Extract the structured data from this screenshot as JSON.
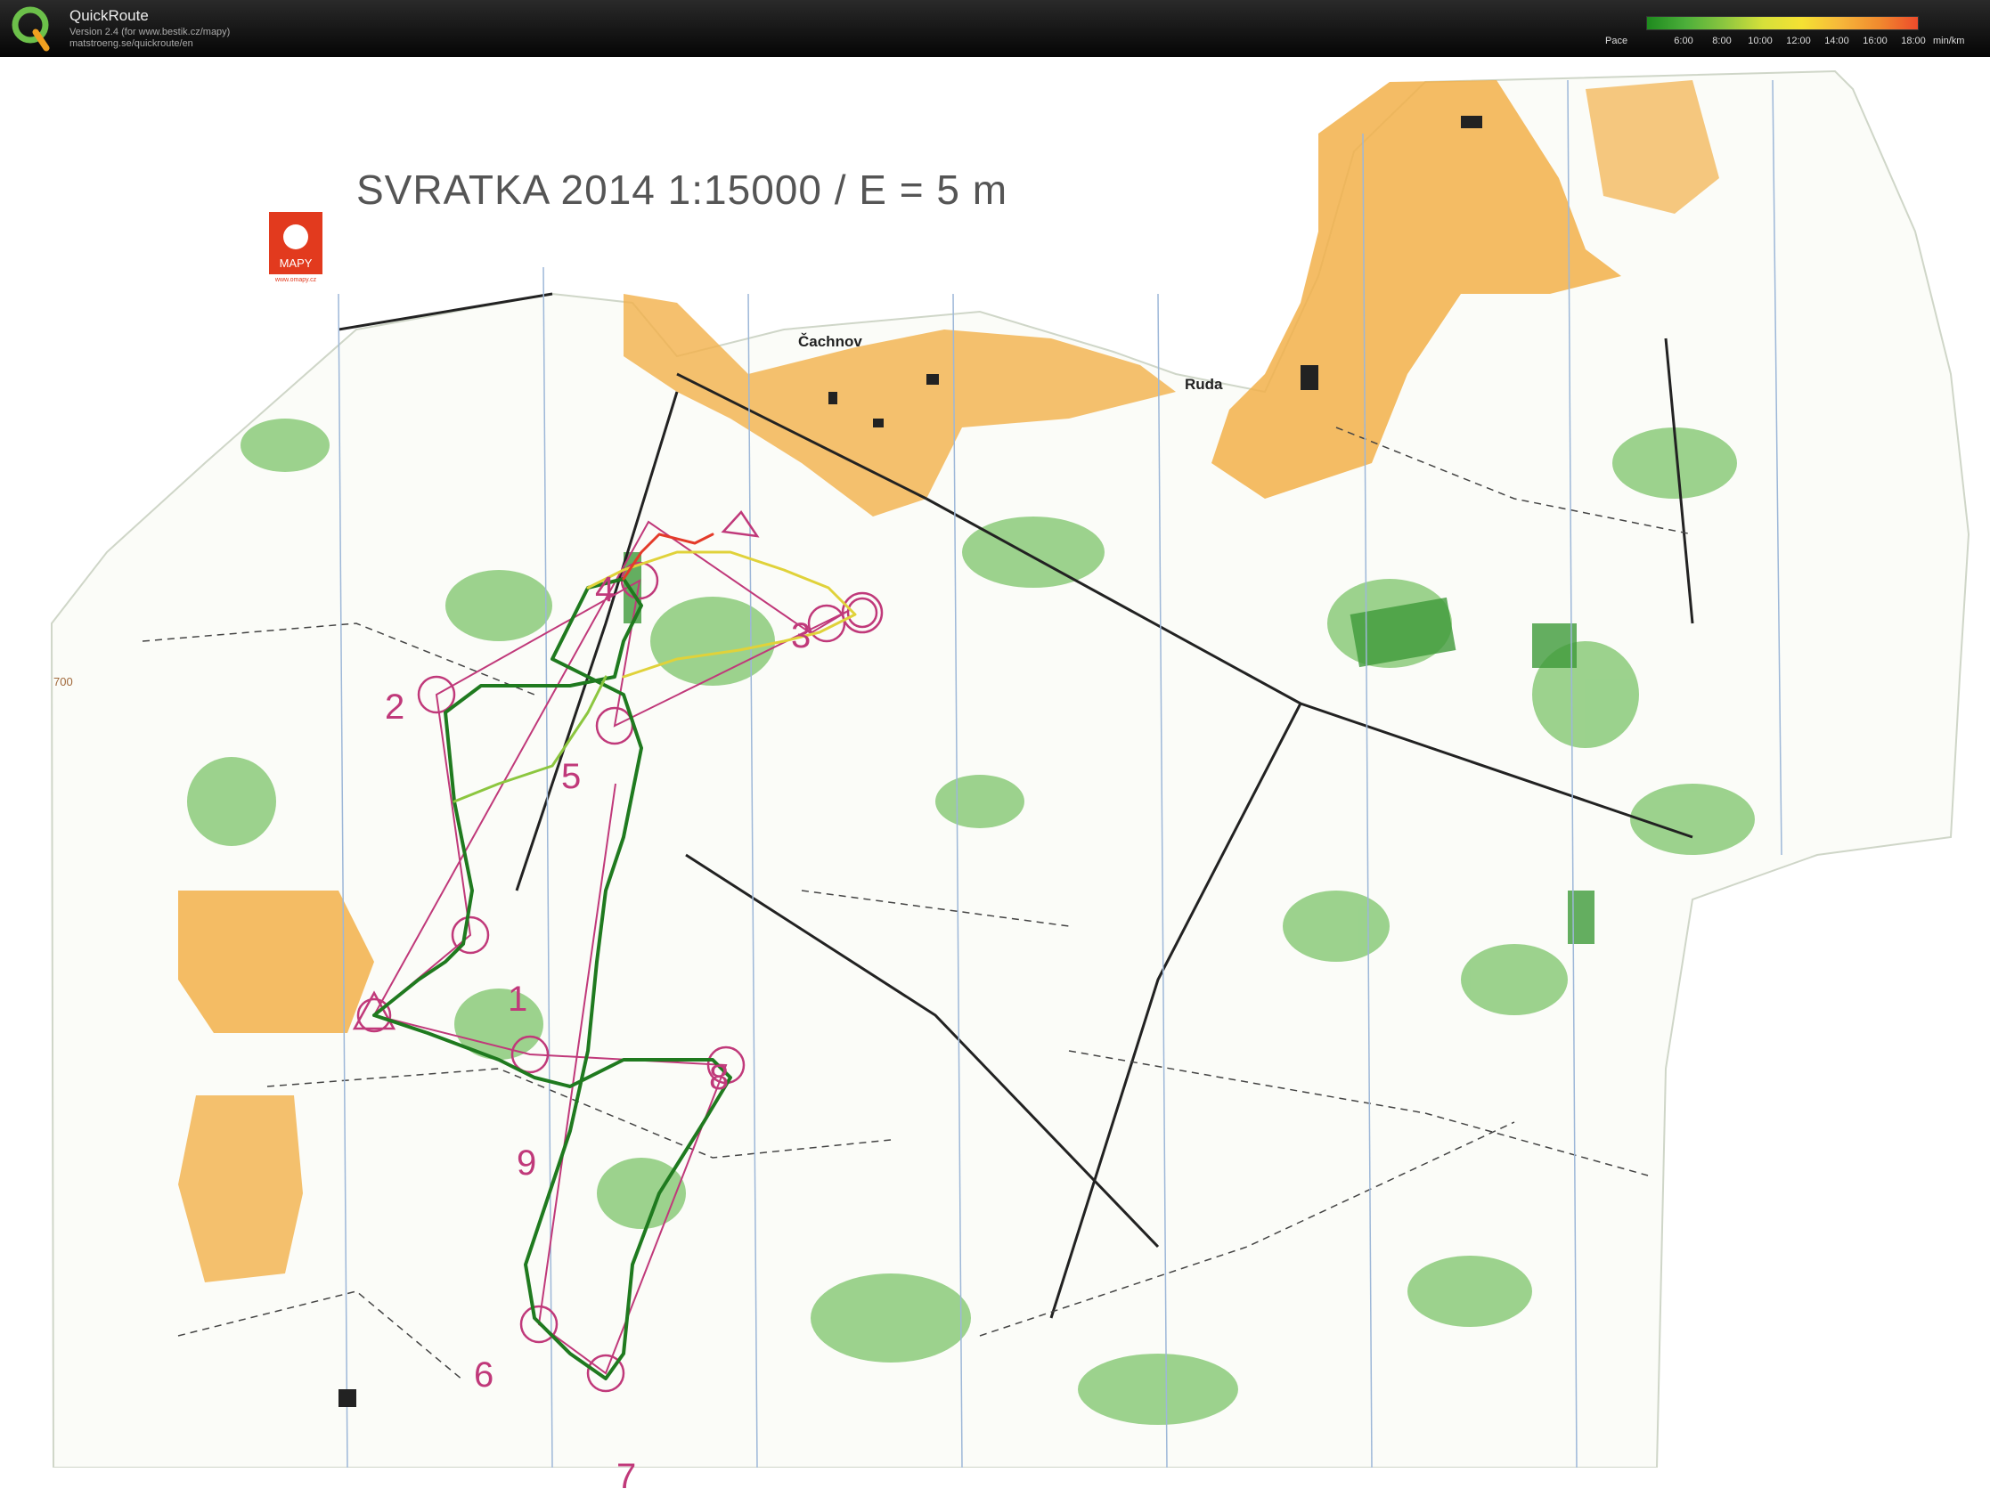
{
  "app": {
    "name": "QuickRoute",
    "version": "Version 2.4  (for www.bestik.cz/mapy)",
    "url": "matstroeng.se/quickroute/en"
  },
  "pace_legend": {
    "label": "Pace",
    "ticks": [
      "6:00",
      "8:00",
      "10:00",
      "12:00",
      "14:00",
      "16:00",
      "18:00"
    ],
    "unit": "min/km"
  },
  "map": {
    "title": "SVRATKA 2014    1:15000 / E = 5 m",
    "brand": "MAPY",
    "brand_url": "www.omapy.cz",
    "places": [
      "Čachnov",
      "Ruda"
    ],
    "contour_label": "700",
    "controls": [
      "1",
      "2",
      "3",
      "4",
      "5",
      "6",
      "7",
      "8",
      "9"
    ]
  },
  "colors": {
    "open_land": "#f2b04a",
    "forest_green": "#6dbb5a",
    "course": "#c0397a",
    "route_fast": "#1f7a1f",
    "route_slow": "#e43b2a"
  }
}
